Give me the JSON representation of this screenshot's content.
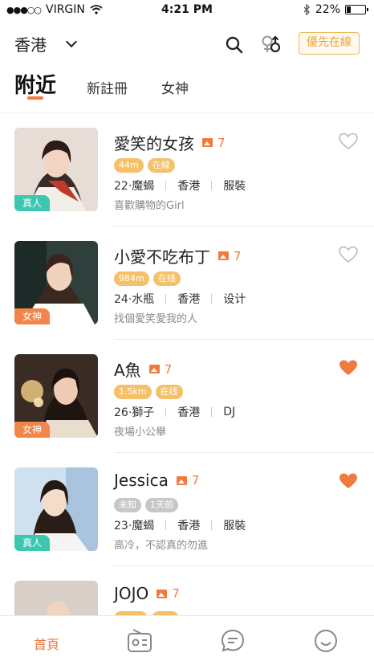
{
  "status": {
    "carrier": "VIRGIN",
    "time": "4:21 PM",
    "battery": "22%",
    "battery_level": 0.22
  },
  "header": {
    "city": "香港",
    "priority_label": "優先在線"
  },
  "tabs": [
    {
      "label": "附近",
      "active": true
    },
    {
      "label": "新註冊",
      "active": false
    },
    {
      "label": "女神",
      "active": false
    }
  ],
  "profiles": [
    {
      "name": "愛笑的女孩",
      "photos": "7",
      "tag": "真人",
      "tag_type": "real",
      "pill1": "44m",
      "pill2": "在線",
      "gray": false,
      "age_sign": "22·魔蝎",
      "place": "香港",
      "job": "服裝",
      "bio": "喜歡購物的Girl",
      "liked": false
    },
    {
      "name": "小愛不吃布丁",
      "photos": "7",
      "tag": "女神",
      "tag_type": "goddess",
      "pill1": "984m",
      "pill2": "在线",
      "gray": false,
      "age_sign": "24·水瓶",
      "place": "香港",
      "job": "设计",
      "bio": "找個愛笑愛我的人",
      "liked": false
    },
    {
      "name": "A魚",
      "photos": "7",
      "tag": "女神",
      "tag_type": "goddess",
      "pill1": "1.5km",
      "pill2": "在线",
      "gray": false,
      "age_sign": "26·獅子",
      "place": "香港",
      "job": "DJ",
      "bio": "夜場小公舉",
      "liked": true
    },
    {
      "name": "Jessica",
      "photos": "7",
      "tag": "真人",
      "tag_type": "real",
      "pill1": "未知",
      "pill2": "1天前",
      "gray": true,
      "age_sign": "23·魔蝎",
      "place": "香港",
      "job": "服裝",
      "bio": "高冷，不認真的勿進",
      "liked": true
    },
    {
      "name": "JOJO",
      "photos": "7",
      "tag": "",
      "tag_type": "",
      "pill1": "",
      "pill2": "",
      "gray": false,
      "age_sign": "",
      "place": "",
      "job": "",
      "bio": "",
      "liked": false
    }
  ],
  "bottom_nav": {
    "home_label": "首頁"
  },
  "colors": {
    "accent": "#f07b3f",
    "pill": "#f5c06a",
    "real_tag": "#3ec7b0",
    "goddess_tag": "#f2854a",
    "priority": "#f0b757"
  }
}
